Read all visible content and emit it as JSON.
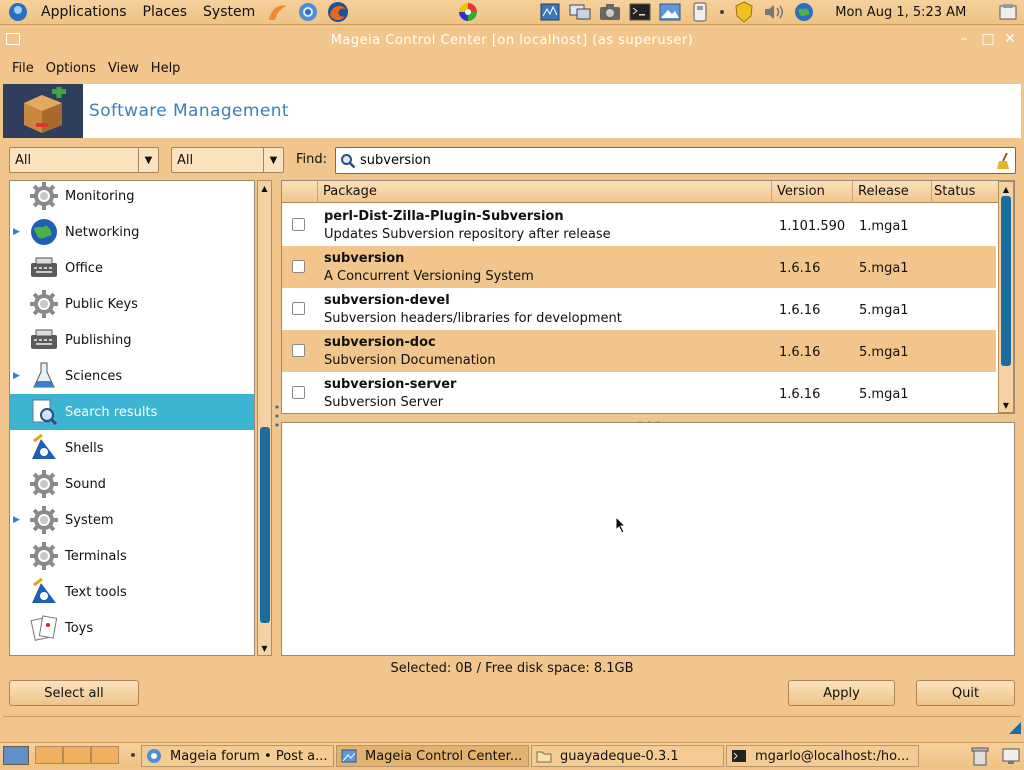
{
  "top_panel": {
    "menus": [
      "Applications",
      "Places",
      "System"
    ],
    "launchers": [
      "firefox-launcher-icon",
      "chromium-launcher-icon",
      "firefox-browser-icon",
      "picasa-icon"
    ],
    "tray_icons": [
      "network-monitor-icon",
      "display-icon",
      "screenshot-icon",
      "terminal-icon",
      "image-viewer-icon",
      "removable-drive-icon",
      "update-notifier-icon",
      "volume-icon",
      "network-globe-icon"
    ],
    "clock": "Mon Aug  1,  5:23 AM"
  },
  "window": {
    "title": "Mageia Control Center  [on localhost] (as superuser)"
  },
  "menubar": {
    "items": [
      "File",
      "Options",
      "View",
      "Help"
    ]
  },
  "banner": {
    "title": "Software Management"
  },
  "filters": {
    "combo1_value": "All",
    "combo2_value": "All",
    "find_label": "Find:",
    "search_value": "subversion"
  },
  "categories": [
    {
      "label": "Monitoring",
      "icon": "gear-icon",
      "expandable": false
    },
    {
      "label": "Networking",
      "icon": "globe-icon",
      "expandable": true
    },
    {
      "label": "Office",
      "icon": "typewriter-icon",
      "expandable": false
    },
    {
      "label": "Public Keys",
      "icon": "gear-icon",
      "expandable": false
    },
    {
      "label": "Publishing",
      "icon": "typewriter-icon",
      "expandable": false
    },
    {
      "label": "Sciences",
      "icon": "flask-icon",
      "expandable": true
    },
    {
      "label": "Search results",
      "icon": "search-results-icon",
      "expandable": false,
      "selected": true
    },
    {
      "label": "Shells",
      "icon": "shell-icon",
      "expandable": false
    },
    {
      "label": "Sound",
      "icon": "gear-icon",
      "expandable": false
    },
    {
      "label": "System",
      "icon": "gear-icon",
      "expandable": true
    },
    {
      "label": "Terminals",
      "icon": "gear-icon",
      "expandable": false
    },
    {
      "label": "Text tools",
      "icon": "shell-icon",
      "expandable": false
    },
    {
      "label": "Toys",
      "icon": "playing-cards-icon",
      "expandable": false
    }
  ],
  "package_table": {
    "columns": [
      "Package",
      "Version",
      "Release",
      "Status"
    ],
    "rows": [
      {
        "name": "perl-Dist-Zilla-Plugin-Subversion",
        "summary": "Updates Subversion repository after release",
        "version": "1.101.590",
        "release": "1.mga1",
        "status": ""
      },
      {
        "name": "subversion",
        "summary": "A Concurrent Versioning System",
        "version": "1.6.16",
        "release": "5.mga1",
        "status": ""
      },
      {
        "name": "subversion-devel",
        "summary": "Subversion headers/libraries for development",
        "version": "1.6.16",
        "release": "5.mga1",
        "status": ""
      },
      {
        "name": "subversion-doc",
        "summary": "Subversion Documenation",
        "version": "1.6.16",
        "release": "5.mga1",
        "status": ""
      },
      {
        "name": "subversion-server",
        "summary": "Subversion Server",
        "version": "1.6.16",
        "release": "5.mga1",
        "status": ""
      }
    ]
  },
  "status_line": "Selected: 0B / Free disk space: 8.1GB",
  "buttons": {
    "select_all": "Select all",
    "apply": "Apply",
    "quit": "Quit"
  },
  "taskbar": {
    "tasks": [
      {
        "label": "Mageia forum • Post a...",
        "icon": "browser-icon",
        "active": false
      },
      {
        "label": "Mageia Control Center...",
        "icon": "control-center-icon",
        "active": true
      },
      {
        "label": "guayadeque-0.3.1",
        "icon": "folder-icon",
        "active": false
      },
      {
        "label": "mgarlo@localhost:/ho...",
        "icon": "terminal-icon",
        "active": false
      }
    ]
  },
  "colors": {
    "theme": "#f1c58b",
    "selection": "#3db4d1",
    "banner_title": "#3a7fbf",
    "scroll_thumb": "#1a6da1"
  }
}
